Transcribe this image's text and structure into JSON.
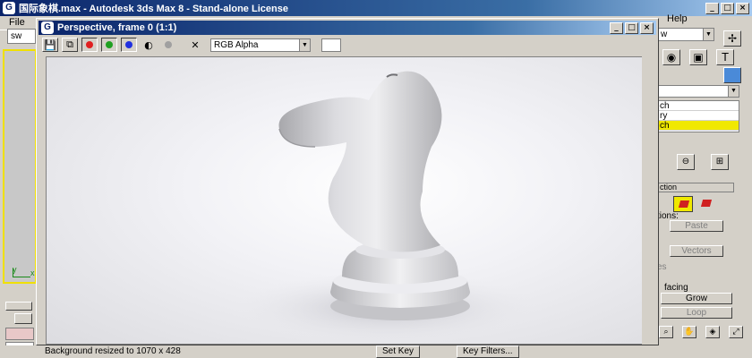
{
  "main_window": {
    "title": "国际象棋.max - Autodesk 3ds Max 8 - Stand-alone License",
    "app_icon": "G",
    "menu": {
      "file": "File",
      "help": "Help"
    },
    "left_combo": "sw",
    "right_combo": "w",
    "status_text": "Background resized to 1070 x 428",
    "status_buttons": [
      "Set Key",
      "Key Filters..."
    ]
  },
  "frame_window": {
    "title": "Perspective, frame 0 (1:1)",
    "app_icon": "G",
    "channel_select": "RGB Alpha",
    "channel_colors": {
      "red": "#e02020",
      "green": "#20a020",
      "blue": "#2030e0"
    }
  },
  "command_panel": {
    "list_items": [
      "ch",
      "ry",
      "ch"
    ],
    "section_title": "ction",
    "labels": {
      "selection_level": "tions:",
      "paste": "Paste",
      "vectors": "Vectors",
      "es": "es",
      "facing": "facing",
      "grow": "Grow",
      "loop": "Loop"
    }
  },
  "axis_labels": {
    "y": "y",
    "x": "x"
  }
}
